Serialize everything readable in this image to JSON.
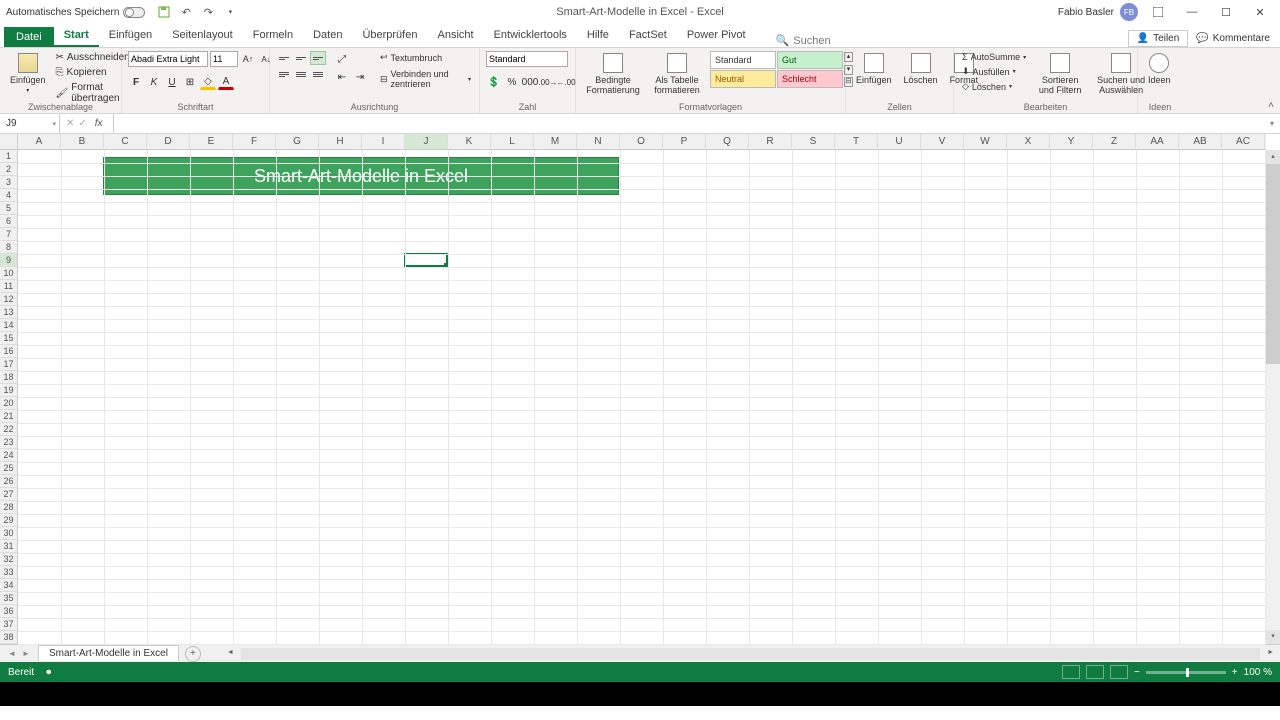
{
  "titlebar": {
    "autosave_label": "Automatisches Speichern",
    "doc_title": "Smart-Art-Modelle in Excel",
    "app_name": "Excel",
    "user_name": "Fabio Basler",
    "user_initials": "FB"
  },
  "tabs": {
    "file": "Datei",
    "items": [
      "Start",
      "Einfügen",
      "Seitenlayout",
      "Formeln",
      "Daten",
      "Überprüfen",
      "Ansicht",
      "Entwicklertools",
      "Hilfe",
      "FactSet",
      "Power Pivot"
    ],
    "active_index": 0,
    "search_placeholder": "Suchen",
    "share": "Teilen",
    "comments": "Kommentare"
  },
  "ribbon": {
    "clipboard": {
      "paste": "Einfügen",
      "cut": "Ausschneiden",
      "copy": "Kopieren",
      "format_painter": "Format übertragen",
      "label": "Zwischenablage"
    },
    "font": {
      "name": "Abadi Extra Light",
      "size": "11",
      "label": "Schriftart"
    },
    "alignment": {
      "wrap": "Textumbruch",
      "merge": "Verbinden und zentrieren",
      "label": "Ausrichtung"
    },
    "number": {
      "format": "Standard",
      "label": "Zahl"
    },
    "styles": {
      "cond": "Bedingte Formatierung",
      "table": "Als Tabelle formatieren",
      "standard": "Standard",
      "gut": "Gut",
      "neutral": "Neutral",
      "schlecht": "Schlecht",
      "label": "Formatvorlagen"
    },
    "cells": {
      "insert": "Einfügen",
      "delete": "Löschen",
      "format": "Format",
      "label": "Zellen"
    },
    "editing": {
      "autosum": "AutoSumme",
      "fill": "Ausfüllen",
      "clear": "Löschen",
      "sort": "Sortieren und Filtern",
      "find": "Suchen und Auswählen",
      "label": "Bearbeiten"
    },
    "ideas": {
      "btn": "Ideen",
      "label": "Ideen"
    }
  },
  "formula": {
    "cell_ref": "J9"
  },
  "columns": [
    "A",
    "B",
    "C",
    "D",
    "E",
    "F",
    "G",
    "H",
    "I",
    "J",
    "K",
    "L",
    "M",
    "N",
    "O",
    "P",
    "Q",
    "R",
    "S",
    "T",
    "U",
    "V",
    "W",
    "X",
    "Y",
    "Z",
    "AA",
    "AB",
    "AC"
  ],
  "row_count": 38,
  "selected_col_index": 9,
  "selected_row": 9,
  "banner_text": "Smart-Art-Modelle in Excel",
  "sheet": {
    "name": "Smart-Art-Modelle in Excel"
  },
  "status": {
    "ready": "Bereit",
    "zoom": "100 %"
  }
}
